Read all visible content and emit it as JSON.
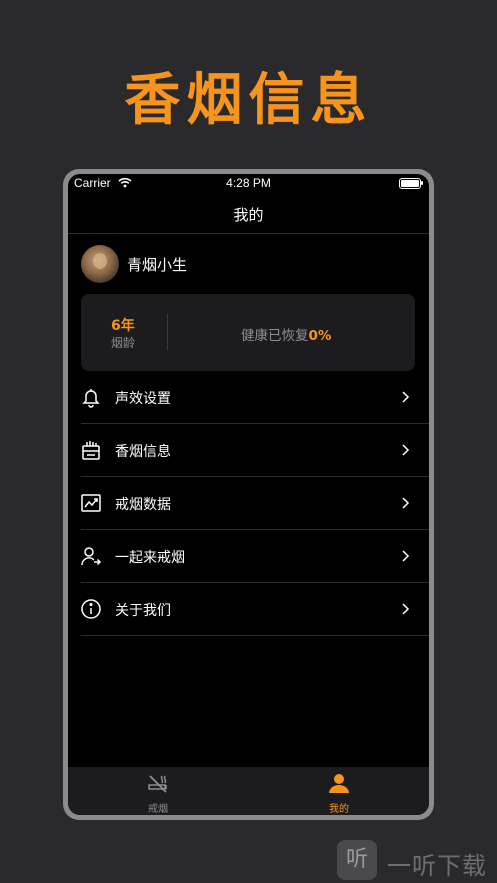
{
  "promo": {
    "title": "香烟信息"
  },
  "status_bar": {
    "carrier": "Carrier",
    "time": "4:28 PM"
  },
  "nav": {
    "title": "我的"
  },
  "profile": {
    "username": "青烟小生"
  },
  "stats": {
    "years_value": "6年",
    "years_label": "烟龄",
    "health_text": "健康已恢复",
    "health_value": "0%"
  },
  "menu": {
    "items": [
      {
        "label": "声效设置",
        "icon": "bell-icon"
      },
      {
        "label": "香烟信息",
        "icon": "cigarette-box-icon"
      },
      {
        "label": "戒烟数据",
        "icon": "trend-chart-icon"
      },
      {
        "label": "一起来戒烟",
        "icon": "user-share-icon"
      },
      {
        "label": "关于我们",
        "icon": "info-icon"
      }
    ]
  },
  "tabbar": {
    "tabs": [
      {
        "label": "戒烟",
        "icon": "no-smoking-icon",
        "active": false
      },
      {
        "label": "我的",
        "icon": "person-icon",
        "active": true
      }
    ]
  },
  "watermark": {
    "glyph": "听",
    "text": "一听下载"
  },
  "colors": {
    "accent": "#f7941d",
    "background": "#2a2a2c",
    "screen": "#000000",
    "card": "#1c1c1e"
  }
}
